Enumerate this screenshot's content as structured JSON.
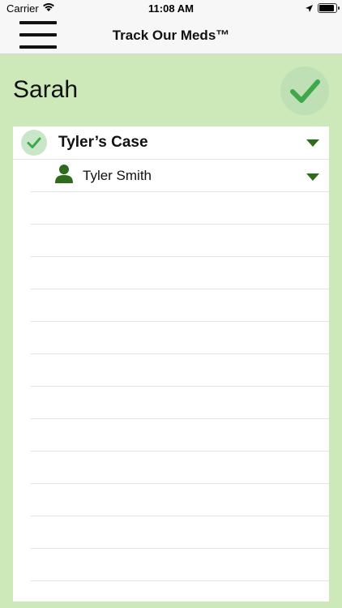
{
  "status_bar": {
    "carrier": "Carrier",
    "time": "11:08 AM"
  },
  "nav": {
    "title": "Track Our Meds™"
  },
  "page": {
    "title": "Sarah"
  },
  "list": {
    "group": {
      "label": "Tyler’s Case",
      "checked": true
    },
    "person": {
      "name": "Tyler Smith"
    },
    "empty_rows": 13
  },
  "colors": {
    "background": "#cde9ba",
    "accent": "#2f6b1c",
    "check": "#3fa84a"
  }
}
